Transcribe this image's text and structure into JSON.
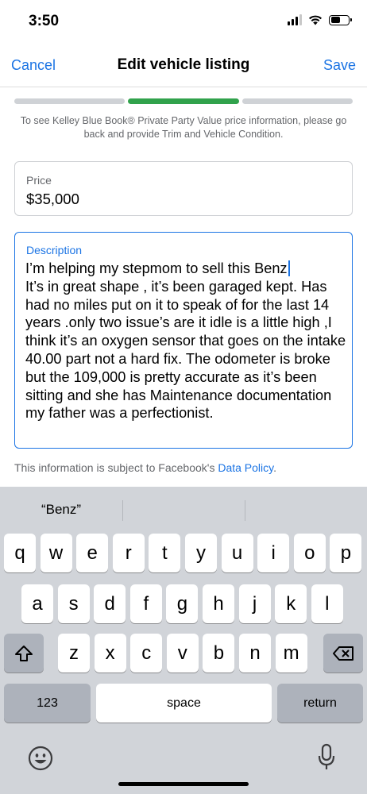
{
  "status_bar": {
    "time": "3:50",
    "battery_fraction": 0.55
  },
  "nav": {
    "cancel_label": "Cancel",
    "title": "Edit vehicle listing",
    "save_label": "Save"
  },
  "progress": {
    "steps": 3,
    "active_step": 2
  },
  "kbb_note": "To see Kelley Blue Book® Private Party Value price information, please go back and provide Trim and Vehicle Condition.",
  "price": {
    "label": "Price",
    "value": "$35,000"
  },
  "description": {
    "label": "Description",
    "value": "I’m helping my stepmom to sell this Benz\nIt’s in great shape , it’s been garaged kept. Has had no miles put on it to speak of for the last 14 years .only two issue’s are it idle is a little high ,I think it’s an oxygen sensor that goes on the intake 40.00 part not a hard fix. The odometer is broke but the 109,000 is pretty accurate as it’s been sitting and she has Maintenance documentation my father was a perfectionist."
  },
  "policy": {
    "text": "This information is subject to Facebook's ",
    "link": "Data Policy",
    "end": "."
  },
  "keyboard": {
    "suggestions": [
      "“Benz”",
      "",
      ""
    ],
    "row1": [
      "q",
      "w",
      "e",
      "r",
      "t",
      "y",
      "u",
      "i",
      "o",
      "p"
    ],
    "row2": [
      "a",
      "s",
      "d",
      "f",
      "g",
      "h",
      "j",
      "k",
      "l"
    ],
    "row3": [
      "z",
      "x",
      "c",
      "v",
      "b",
      "n",
      "m"
    ],
    "numbers_label": "123",
    "space_label": "space",
    "return_label": "return",
    "icons": {
      "shift": "shift-icon",
      "delete": "backspace-icon",
      "emoji": "emoji-icon",
      "dictation": "microphone-icon"
    }
  },
  "colors": {
    "accent": "#1b74e4",
    "progress_active": "#31a24c",
    "progress_inactive": "#cfd2d6",
    "keyboard_bg": "#d1d4d9"
  }
}
